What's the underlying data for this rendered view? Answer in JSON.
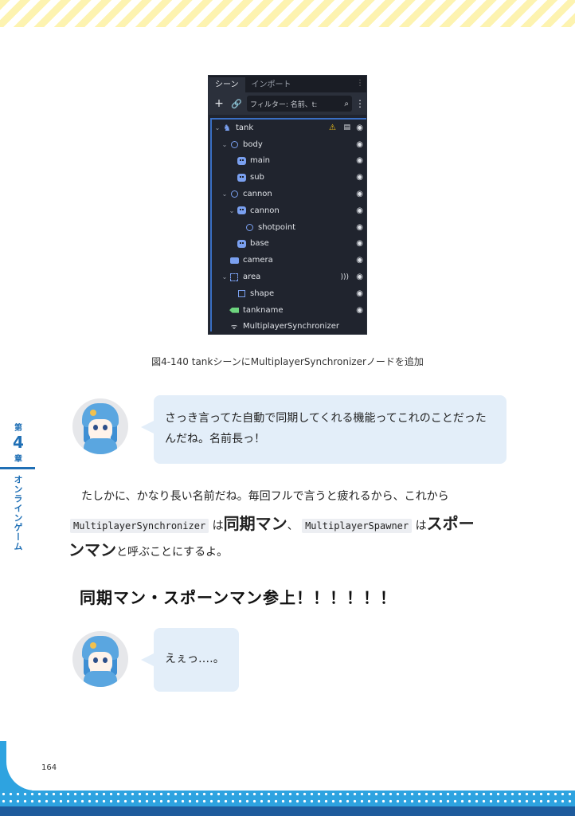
{
  "chapter": {
    "kanji_top": "第",
    "number": "4",
    "kanji_bottom": "章",
    "title": "オンラインゲーム"
  },
  "scene_panel": {
    "tabs": [
      "シーン",
      "インポート"
    ],
    "toolbar": {
      "add": "+",
      "filter_placeholder": "フィルター: 名前、t:"
    },
    "nodes": [
      {
        "label": "tank",
        "icon": "tank-node-icon",
        "depth": 0,
        "expanded": true,
        "warning": true,
        "script": true
      },
      {
        "label": "body",
        "icon": "node3d-ring-icon",
        "depth": 1,
        "expanded": true
      },
      {
        "label": "main",
        "icon": "mesh-sprite-icon",
        "depth": 2
      },
      {
        "label": "sub",
        "icon": "mesh-sprite-icon",
        "depth": 2
      },
      {
        "label": "cannon",
        "icon": "node3d-ring-icon",
        "depth": 1,
        "expanded": true
      },
      {
        "label": "cannon",
        "icon": "mesh-sprite-icon",
        "depth": 2,
        "expanded": true
      },
      {
        "label": "shotpoint",
        "icon": "node3d-ring-icon",
        "depth": 3
      },
      {
        "label": "base",
        "icon": "mesh-sprite-icon",
        "depth": 2
      },
      {
        "label": "camera",
        "icon": "camera-icon",
        "depth": 1
      },
      {
        "label": "area",
        "icon": "area-icon",
        "depth": 1,
        "expanded": true,
        "signal": true
      },
      {
        "label": "shape",
        "icon": "shape-icon",
        "depth": 2
      },
      {
        "label": "tankname",
        "icon": "label-tag-icon",
        "depth": 1
      },
      {
        "label": "MultiplayerSynchronizer",
        "icon": "multiplayer-sync-icon",
        "depth": 1,
        "no_eye": true
      }
    ]
  },
  "caption": "図4-140 tankシーンにMultiplayerSynchronizerノードを追加",
  "dialogue1": {
    "text_line1": "さっき言ってた自動で同期してくれる機能ってこれのことだった",
    "text_line2": "んだね。名前長っ！"
  },
  "paragraph": {
    "line1": "たしかに、かなり長い名前だね。毎回フルで言うと疲れるから、これから",
    "code1": "MultiplayerSynchronizer",
    "ha1": "は",
    "term1": "同期マン",
    "comma": "、",
    "code2": "MultiplayerSpawner",
    "ha2": "は",
    "term2a": "スポー",
    "term2b": "ンマン",
    "tail": "と呼ぶことにするよ。"
  },
  "shout": "同期マン・スポーンマン参上！！！！！！",
  "dialogue2": {
    "text": "えぇっ‥‥。"
  },
  "page_number": "164",
  "colors": {
    "accent_blue": "#2ea3e0",
    "chapter_blue": "#1f6fb5",
    "bubble": "#e3eef9",
    "stripe_yellow": "#fdf3b0"
  }
}
